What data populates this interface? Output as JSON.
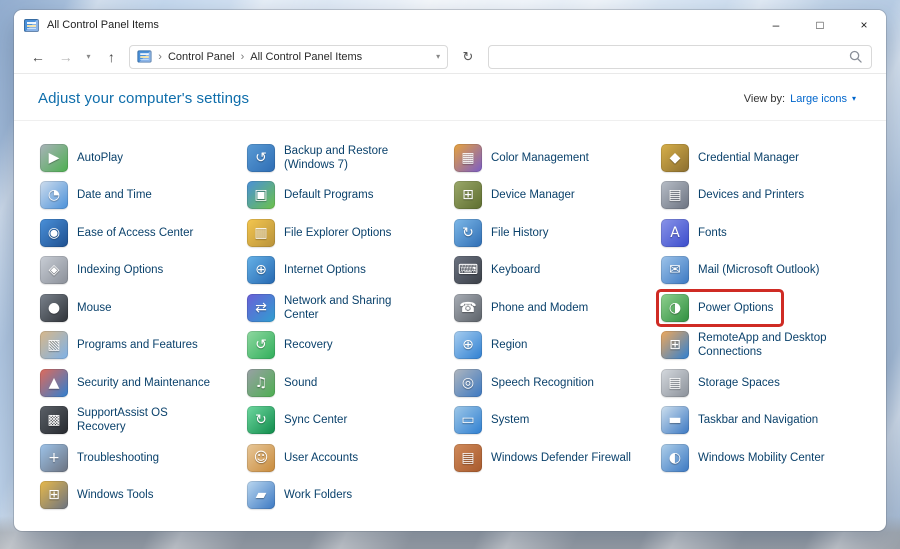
{
  "window": {
    "title": "All Control Panel Items",
    "controls": {
      "minimize": "–",
      "maximize": "□",
      "close": "×"
    }
  },
  "navbar": {
    "back_glyph": "←",
    "forward_glyph": "→",
    "recent_chevron": "▾",
    "up_glyph": "↑",
    "refresh_glyph": "↻",
    "crumb_chevron": "›",
    "address_dropdown": "▾",
    "breadcrumb": {
      "segment1": "Control Panel",
      "segment2": "All Control Panel Items"
    },
    "search_placeholder": ""
  },
  "header": {
    "title": "Adjust your computer's settings",
    "view_by_label": "View by:",
    "view_by_value": "Large icons",
    "view_by_chevron": "▾"
  },
  "accent": {
    "highlight_red": "#cf2b24",
    "link_blue": "#0066cc",
    "header_blue": "#0f6eab",
    "item_text": "#0a416b"
  },
  "items": [
    {
      "id": "autoplay",
      "label": "AutoPlay",
      "icon": "autoplay-icon",
      "glyph": "▶",
      "colors": [
        "#aab2ba",
        "#4caf50"
      ],
      "highlighted": false
    },
    {
      "id": "backup-and-restore",
      "label": "Backup and Restore (Windows 7)",
      "icon": "backup-restore-icon",
      "glyph": "↺",
      "colors": [
        "#5a9bd5",
        "#2e6db4"
      ],
      "highlighted": false
    },
    {
      "id": "color-management",
      "label": "Color Management",
      "icon": "color-management-icon",
      "glyph": "▦",
      "colors": [
        "#e8a33d",
        "#7a5cc7"
      ],
      "highlighted": false
    },
    {
      "id": "credential-manager",
      "label": "Credential Manager",
      "icon": "credential-manager-icon",
      "glyph": "◆",
      "colors": [
        "#d8b04a",
        "#8a6d2f"
      ],
      "highlighted": false
    },
    {
      "id": "date-and-time",
      "label": "Date and Time",
      "icon": "date-time-icon",
      "glyph": "◔",
      "colors": [
        "#cfdded",
        "#4a90d9"
      ],
      "highlighted": false
    },
    {
      "id": "default-programs",
      "label": "Default Programs",
      "icon": "default-programs-icon",
      "glyph": "▣",
      "colors": [
        "#4a90d9",
        "#6cc24a"
      ],
      "highlighted": false
    },
    {
      "id": "device-manager",
      "label": "Device Manager",
      "icon": "device-manager-icon",
      "glyph": "⊞",
      "colors": [
        "#9ba86a",
        "#5d6d2e"
      ],
      "highlighted": false
    },
    {
      "id": "devices-and-printers",
      "label": "Devices and Printers",
      "icon": "devices-printers-icon",
      "glyph": "▤",
      "colors": [
        "#b8bec7",
        "#6b7280"
      ],
      "highlighted": false
    },
    {
      "id": "ease-of-access-center",
      "label": "Ease of Access Center",
      "icon": "ease-of-access-icon",
      "glyph": "◉",
      "colors": [
        "#4a90d9",
        "#1e4f8f"
      ],
      "highlighted": false
    },
    {
      "id": "file-explorer-options",
      "label": "File Explorer Options",
      "icon": "file-explorer-options-icon",
      "glyph": "▥",
      "colors": [
        "#f4c64f",
        "#b8923a"
      ],
      "highlighted": false
    },
    {
      "id": "file-history",
      "label": "File History",
      "icon": "file-history-icon",
      "glyph": "↻",
      "colors": [
        "#7db8e8",
        "#2e6db4"
      ],
      "highlighted": false
    },
    {
      "id": "fonts",
      "label": "Fonts",
      "icon": "fonts-icon",
      "glyph": "A",
      "colors": [
        "#8a94e8",
        "#3a4ccc"
      ],
      "highlighted": false
    },
    {
      "id": "indexing-options",
      "label": "Indexing Options",
      "icon": "indexing-options-icon",
      "glyph": "◈",
      "colors": [
        "#c9ced6",
        "#8a8f98"
      ],
      "highlighted": false
    },
    {
      "id": "internet-options",
      "label": "Internet Options",
      "icon": "internet-options-icon",
      "glyph": "⊕",
      "colors": [
        "#66b2e8",
        "#2567b0"
      ],
      "highlighted": false
    },
    {
      "id": "keyboard",
      "label": "Keyboard",
      "icon": "keyboard-icon",
      "glyph": "⌨",
      "colors": [
        "#6b7280",
        "#3a3f47"
      ],
      "highlighted": false
    },
    {
      "id": "mail",
      "label": "Mail (Microsoft Outlook)",
      "icon": "mail-icon",
      "glyph": "✉",
      "colors": [
        "#9ec4ea",
        "#3b78c2"
      ],
      "highlighted": false
    },
    {
      "id": "mouse",
      "label": "Mouse",
      "icon": "mouse-icon",
      "glyph": "●",
      "colors": [
        "#7a828c",
        "#2f3338"
      ],
      "highlighted": false
    },
    {
      "id": "network-and-sharing-center",
      "label": "Network and Sharing Center",
      "icon": "network-sharing-icon",
      "glyph": "⇄",
      "colors": [
        "#6a5fd8",
        "#2f9fd0"
      ],
      "highlighted": false
    },
    {
      "id": "phone-and-modem",
      "label": "Phone and Modem",
      "icon": "phone-modem-icon",
      "glyph": "☎",
      "colors": [
        "#a8adb5",
        "#5b6168"
      ],
      "highlighted": false
    },
    {
      "id": "power-options",
      "label": "Power Options",
      "icon": "power-options-icon",
      "glyph": "◑",
      "colors": [
        "#8fd08f",
        "#2f8f3f"
      ],
      "highlighted": true
    },
    {
      "id": "programs-and-features",
      "label": "Programs and Features",
      "icon": "programs-features-icon",
      "glyph": "▧",
      "colors": [
        "#d8b88a",
        "#7db1e8"
      ],
      "highlighted": false
    },
    {
      "id": "recovery",
      "label": "Recovery",
      "icon": "recovery-icon",
      "glyph": "↺",
      "colors": [
        "#8fd8a0",
        "#2fae5a"
      ],
      "highlighted": false
    },
    {
      "id": "region",
      "label": "Region",
      "icon": "region-icon",
      "glyph": "⊕",
      "colors": [
        "#a8cef0",
        "#2f7fd1"
      ],
      "highlighted": false
    },
    {
      "id": "remoteapp-and-desktop-connections",
      "label": "RemoteApp and Desktop Connections",
      "icon": "remoteapp-icon",
      "glyph": "⊞",
      "colors": [
        "#f0a85a",
        "#2f7fd1"
      ],
      "highlighted": false
    },
    {
      "id": "security-and-maintenance",
      "label": "Security and Maintenance",
      "icon": "security-maintenance-icon",
      "glyph": "▲",
      "colors": [
        "#e06a5a",
        "#2f7fd1"
      ],
      "highlighted": false
    },
    {
      "id": "sound",
      "label": "Sound",
      "icon": "sound-icon",
      "glyph": "♫",
      "colors": [
        "#9aa0a6",
        "#4caf50"
      ],
      "highlighted": false
    },
    {
      "id": "speech-recognition",
      "label": "Speech Recognition",
      "icon": "speech-recognition-icon",
      "glyph": "◎",
      "colors": [
        "#b0b6be",
        "#3b78c2"
      ],
      "highlighted": false
    },
    {
      "id": "storage-spaces",
      "label": "Storage Spaces",
      "icon": "storage-spaces-icon",
      "glyph": "▤",
      "colors": [
        "#d5d9de",
        "#8a9099"
      ],
      "highlighted": false
    },
    {
      "id": "supportassist-os-recovery",
      "label": "SupportAssist OS Recovery",
      "icon": "supportassist-icon",
      "glyph": "▩",
      "colors": [
        "#5b6168",
        "#26292e"
      ],
      "highlighted": false
    },
    {
      "id": "sync-center",
      "label": "Sync Center",
      "icon": "sync-center-icon",
      "glyph": "↻",
      "colors": [
        "#6fd8a0",
        "#0f8a4a"
      ],
      "highlighted": false
    },
    {
      "id": "system",
      "label": "System",
      "icon": "system-icon",
      "glyph": "▭",
      "colors": [
        "#9fc8e8",
        "#2f7fd1"
      ],
      "highlighted": false
    },
    {
      "id": "taskbar-and-navigation",
      "label": "Taskbar and Navigation",
      "icon": "taskbar-icon",
      "glyph": "▬",
      "colors": [
        "#cfe0ee",
        "#3b78c2"
      ],
      "highlighted": false
    },
    {
      "id": "troubleshooting",
      "label": "Troubleshooting",
      "icon": "troubleshooting-icon",
      "glyph": "+",
      "colors": [
        "#9ec4ea",
        "#6b7280"
      ],
      "highlighted": false
    },
    {
      "id": "user-accounts",
      "label": "User Accounts",
      "icon": "user-accounts-icon",
      "glyph": "☺",
      "colors": [
        "#e8c89a",
        "#c88a3b"
      ],
      "highlighted": false
    },
    {
      "id": "windows-defender-firewall",
      "label": "Windows Defender Firewall",
      "icon": "firewall-icon",
      "glyph": "▤",
      "colors": [
        "#d08a5a",
        "#a85a2d"
      ],
      "highlighted": false
    },
    {
      "id": "windows-mobility-center",
      "label": "Windows Mobility Center",
      "icon": "mobility-center-icon",
      "glyph": "◐",
      "colors": [
        "#b0d0ea",
        "#3b78c2"
      ],
      "highlighted": false
    },
    {
      "id": "windows-tools",
      "label": "Windows Tools",
      "icon": "windows-tools-icon",
      "glyph": "⊞",
      "colors": [
        "#e8b94a",
        "#6b7280"
      ],
      "highlighted": false
    },
    {
      "id": "work-folders",
      "label": "Work Folders",
      "icon": "work-folders-icon",
      "glyph": "▰",
      "colors": [
        "#bcd8f0",
        "#3b78c2"
      ],
      "highlighted": false
    }
  ]
}
